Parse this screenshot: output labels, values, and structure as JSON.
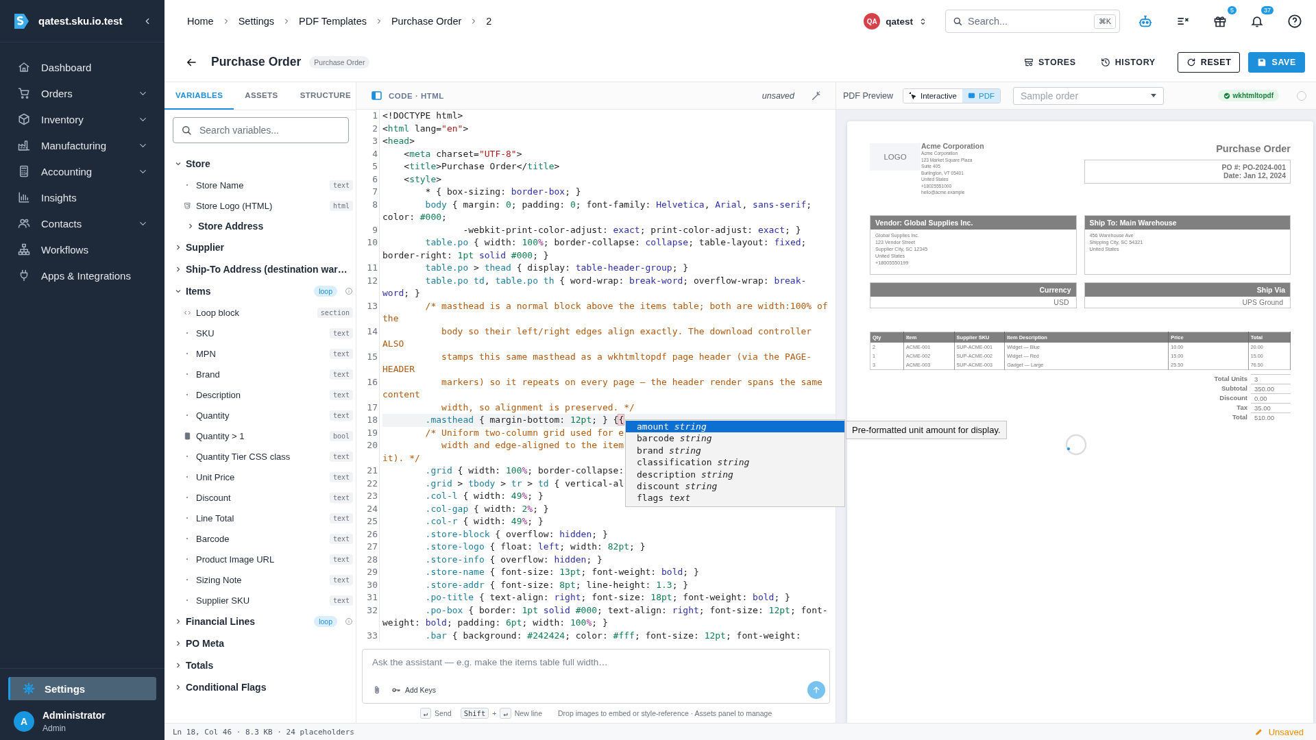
{
  "sidebar": {
    "workspace": "qatest.sku.io.test",
    "nav": [
      {
        "label": "Dashboard",
        "has_submenu": false,
        "selected": false
      },
      {
        "label": "Orders",
        "has_submenu": true,
        "selected": false
      },
      {
        "label": "Inventory",
        "has_submenu": true,
        "selected": false
      },
      {
        "label": "Manufacturing",
        "has_submenu": true,
        "selected": false
      },
      {
        "label": "Accounting",
        "has_submenu": true,
        "selected": false
      },
      {
        "label": "Insights",
        "has_submenu": false,
        "selected": false
      },
      {
        "label": "Contacts",
        "has_submenu": true,
        "selected": false
      },
      {
        "label": "Workflows",
        "has_submenu": false,
        "selected": false
      },
      {
        "label": "Apps & Integrations",
        "has_submenu": false,
        "selected": false
      }
    ],
    "footer_nav": [
      {
        "label": "Settings",
        "selected": true
      }
    ],
    "user": {
      "initial": "A",
      "name": "Administrator",
      "role": "Admin"
    }
  },
  "top_bar": {
    "breadcrumbs": [
      "Home",
      "Settings",
      "PDF Templates",
      "Purchase Order",
      "2"
    ],
    "account": {
      "initials": "QA",
      "name": "qatest"
    },
    "search": {
      "placeholder": "Search...",
      "shortcut": "⌘K"
    },
    "gift_badge": "5",
    "bell_badge": "37"
  },
  "title_bar": {
    "title": "Purchase Order",
    "type_badge": "Purchase Order",
    "actions": [
      {
        "label": "STORES",
        "kind": "text"
      },
      {
        "label": "HISTORY",
        "kind": "text"
      },
      {
        "label": "RESET",
        "kind": "outlined"
      },
      {
        "label": "SAVE",
        "kind": "primary"
      }
    ]
  },
  "variables_panel": {
    "tabs": [
      {
        "label": "VARIABLES",
        "selected": true
      },
      {
        "label": "ASSETS",
        "selected": false
      },
      {
        "label": "STRUCTURE",
        "selected": false
      }
    ],
    "search": {
      "placeholder": "Search variables..."
    },
    "tree": [
      {
        "label": "Store",
        "kind": "group",
        "expanded": true,
        "children": [
          {
            "label": "Store Name",
            "kind": "field",
            "type": "text"
          },
          {
            "label": "Store Logo (HTML)",
            "kind": "html",
            "type": "html"
          },
          {
            "label": "Store Address",
            "kind": "group",
            "expanded": false
          }
        ]
      },
      {
        "label": "Supplier",
        "kind": "group",
        "expanded": false
      },
      {
        "label": "Ship-To Address (destination war…",
        "kind": "group",
        "expanded": false
      },
      {
        "label": "Items",
        "kind": "group",
        "expanded": true,
        "badge": "loop",
        "children": [
          {
            "label": "Loop block",
            "kind": "block",
            "type": "section"
          },
          {
            "label": "SKU",
            "kind": "field",
            "type": "text"
          },
          {
            "label": "MPN",
            "kind": "field",
            "type": "text"
          },
          {
            "label": "Brand",
            "kind": "field",
            "type": "text"
          },
          {
            "label": "Description",
            "kind": "field",
            "type": "text"
          },
          {
            "label": "Quantity",
            "kind": "field",
            "type": "text"
          },
          {
            "label": "Quantity > 1",
            "kind": "condition",
            "type": "bool"
          },
          {
            "label": "Quantity Tier CSS class",
            "kind": "field",
            "type": "text"
          },
          {
            "label": "Unit Price",
            "kind": "field",
            "type": "text"
          },
          {
            "label": "Discount",
            "kind": "field",
            "type": "text"
          },
          {
            "label": "Line Total",
            "kind": "field",
            "type": "text"
          },
          {
            "label": "Barcode",
            "kind": "field",
            "type": "text"
          },
          {
            "label": "Product Image URL",
            "kind": "field",
            "type": "text"
          },
          {
            "label": "Sizing Note",
            "kind": "field",
            "type": "text"
          },
          {
            "label": "Supplier SKU",
            "kind": "field",
            "type": "text"
          }
        ]
      },
      {
        "label": "Financial Lines",
        "kind": "group",
        "expanded": false,
        "badge": "loop"
      },
      {
        "label": "PO Meta",
        "kind": "group",
        "expanded": false
      },
      {
        "label": "Totals",
        "kind": "group",
        "expanded": false
      },
      {
        "label": "Conditional Flags",
        "kind": "group",
        "expanded": false
      }
    ]
  },
  "editor": {
    "title": "CODE · HTML",
    "status": "unsaved",
    "lines": [
      {
        "number": "1",
        "current": false,
        "rows": [
          {
            "tokens": [
              {
                "kind": "plain",
                "text": "<!DOCTYPE html>"
              }
            ]
          }
        ]
      },
      {
        "number": "2",
        "current": false,
        "rows": [
          {
            "tokens": [
              {
                "kind": "plain",
                "text": "<"
              },
              {
                "kind": "tag",
                "text": "html"
              },
              {
                "kind": "plain",
                "text": " lang="
              },
              {
                "kind": "string",
                "text": "\"en\""
              },
              {
                "kind": "plain",
                "text": ">"
              }
            ]
          }
        ]
      },
      {
        "number": "3",
        "current": false,
        "rows": [
          {
            "tokens": [
              {
                "kind": "plain",
                "text": "<"
              },
              {
                "kind": "tag",
                "text": "head"
              },
              {
                "kind": "plain",
                "text": ">"
              }
            ]
          }
        ]
      },
      {
        "number": "4",
        "current": false,
        "rows": [
          {
            "tokens": [
              {
                "kind": "plain",
                "text": "    <"
              },
              {
                "kind": "tag",
                "text": "meta"
              },
              {
                "kind": "plain",
                "text": " charset="
              },
              {
                "kind": "string",
                "text": "\"UTF-8\""
              },
              {
                "kind": "plain",
                "text": ">"
              }
            ]
          }
        ]
      },
      {
        "number": "5",
        "current": false,
        "rows": [
          {
            "tokens": [
              {
                "kind": "plain",
                "text": "    <"
              },
              {
                "kind": "tag",
                "text": "title"
              },
              {
                "kind": "plain",
                "text": ">Purchase Order</"
              },
              {
                "kind": "tag",
                "text": "title"
              },
              {
                "kind": "plain",
                "text": ">"
              }
            ]
          }
        ]
      },
      {
        "number": "6",
        "current": false,
        "rows": [
          {
            "tokens": [
              {
                "kind": "plain",
                "text": "    <"
              },
              {
                "kind": "tag",
                "text": "style"
              },
              {
                "kind": "plain",
                "text": ">"
              }
            ]
          }
        ]
      },
      {
        "number": "7",
        "current": false,
        "rows": [
          {
            "tokens": [
              {
                "kind": "plain",
                "text": "        * { box-sizing: "
              },
              {
                "kind": "keyword",
                "text": "border-box"
              },
              {
                "kind": "plain",
                "text": "; }"
              }
            ]
          }
        ]
      },
      {
        "number": "8",
        "current": false,
        "rows": [
          {
            "tokens": [
              {
                "kind": "selector",
                "text": "        body"
              },
              {
                "kind": "plain",
                "text": " { margin: "
              },
              {
                "kind": "number",
                "text": "0"
              },
              {
                "kind": "plain",
                "text": "; padding: "
              },
              {
                "kind": "number",
                "text": "0"
              },
              {
                "kind": "plain",
                "text": "; font-family: "
              },
              {
                "kind": "keyword",
                "text": "Helvetica"
              },
              {
                "kind": "plain",
                "text": ", "
              },
              {
                "kind": "keyword",
                "text": "Arial"
              },
              {
                "kind": "plain",
                "text": ", "
              },
              {
                "kind": "keyword",
                "text": "sans-serif"
              },
              {
                "kind": "plain",
                "text": ";"
              }
            ]
          },
          {
            "tokens": [
              {
                "kind": "plain",
                "text": "color: "
              },
              {
                "kind": "number",
                "text": "#000"
              },
              {
                "kind": "plain",
                "text": ";"
              }
            ]
          }
        ]
      },
      {
        "number": "9",
        "current": false,
        "rows": [
          {
            "tokens": [
              {
                "kind": "plain",
                "text": "               -webkit-print-color-adjust: "
              },
              {
                "kind": "keyword",
                "text": "exact"
              },
              {
                "kind": "plain",
                "text": "; print-color-adjust: "
              },
              {
                "kind": "keyword",
                "text": "exact"
              },
              {
                "kind": "plain",
                "text": "; }"
              }
            ]
          }
        ]
      },
      {
        "number": "10",
        "current": false,
        "rows": [
          {
            "tokens": [
              {
                "kind": "selector",
                "text": "        table.po"
              },
              {
                "kind": "plain",
                "text": " { width: "
              },
              {
                "kind": "number",
                "text": "100"
              },
              {
                "kind": "unit",
                "text": "%"
              },
              {
                "kind": "plain",
                "text": "; border-collapse: "
              },
              {
                "kind": "keyword",
                "text": "collapse"
              },
              {
                "kind": "plain",
                "text": "; table-layout: "
              },
              {
                "kind": "keyword",
                "text": "fixed"
              },
              {
                "kind": "plain",
                "text": ";"
              }
            ]
          },
          {
            "tokens": [
              {
                "kind": "plain",
                "text": "border-right: "
              },
              {
                "kind": "number",
                "text": "1pt"
              },
              {
                "kind": "keyword",
                "text": " solid "
              },
              {
                "kind": "number",
                "text": "#000"
              },
              {
                "kind": "plain",
                "text": "; }"
              }
            ]
          }
        ]
      },
      {
        "number": "11",
        "current": false,
        "rows": [
          {
            "tokens": [
              {
                "kind": "selector",
                "text": "        table.po"
              },
              {
                "kind": "plain",
                "text": " > "
              },
              {
                "kind": "selector",
                "text": "thead"
              },
              {
                "kind": "plain",
                "text": " { display: "
              },
              {
                "kind": "keyword",
                "text": "table-header-group"
              },
              {
                "kind": "plain",
                "text": "; }"
              }
            ]
          }
        ]
      },
      {
        "number": "12",
        "current": false,
        "rows": [
          {
            "tokens": [
              {
                "kind": "selector",
                "text": "        table.po td"
              },
              {
                "kind": "plain",
                "text": ", "
              },
              {
                "kind": "selector",
                "text": "table.po th"
              },
              {
                "kind": "plain",
                "text": " { word-wrap: "
              },
              {
                "kind": "keyword",
                "text": "break-word"
              },
              {
                "kind": "plain",
                "text": "; overflow-wrap: "
              },
              {
                "kind": "keyword",
                "text": "break-"
              }
            ]
          },
          {
            "tokens": [
              {
                "kind": "keyword",
                "text": "word"
              },
              {
                "kind": "plain",
                "text": "; }"
              }
            ]
          }
        ]
      },
      {
        "number": "13",
        "current": false,
        "rows": [
          {
            "tokens": [
              {
                "kind": "comment",
                "text": "        /* masthead is a normal block above the items table; both are width:100% of"
              }
            ]
          },
          {
            "tokens": [
              {
                "kind": "comment",
                "text": "the"
              }
            ]
          }
        ]
      },
      {
        "number": "14",
        "current": false,
        "rows": [
          {
            "tokens": [
              {
                "kind": "comment",
                "text": "           body so their left/right edges align exactly. The download controller"
              }
            ]
          },
          {
            "tokens": [
              {
                "kind": "comment",
                "text": "ALSO"
              }
            ]
          }
        ]
      },
      {
        "number": "15",
        "current": false,
        "rows": [
          {
            "tokens": [
              {
                "kind": "comment",
                "text": "           stamps this same masthead as a wkhtmltopdf page header (via the PAGE-"
              }
            ]
          },
          {
            "tokens": [
              {
                "kind": "comment",
                "text": "HEADER"
              }
            ]
          }
        ]
      },
      {
        "number": "16",
        "current": false,
        "rows": [
          {
            "tokens": [
              {
                "kind": "comment",
                "text": "           markers) so it repeats on every page — the header render spans the same"
              }
            ]
          },
          {
            "tokens": [
              {
                "kind": "comment",
                "text": "content"
              }
            ]
          }
        ]
      },
      {
        "number": "17",
        "current": false,
        "rows": [
          {
            "tokens": [
              {
                "kind": "comment",
                "text": "           width, so alignment is preserved. */"
              }
            ]
          }
        ]
      },
      {
        "number": "18",
        "current": true,
        "rows": [
          {
            "tokens": [
              {
                "kind": "selector",
                "text": "        .masthead"
              },
              {
                "kind": "plain",
                "text": " { margin-bottom: "
              },
              {
                "kind": "number",
                "text": "12pt"
              },
              {
                "kind": "plain",
                "text": "; } {"
              },
              {
                "kind": "bracket",
                "text": "{"
              }
            ]
          }
        ]
      },
      {
        "number": "19",
        "current": false,
        "rows": [
          {
            "tokens": [
              {
                "kind": "comment",
                "text": "        /* Uniform two-column grid used for e"
              }
            ]
          }
        ]
      },
      {
        "number": "20",
        "current": false,
        "rows": [
          {
            "tokens": [
              {
                "kind": "comment",
                "text": "           width and edge-aligned to the item"
              }
            ]
          },
          {
            "tokens": [
              {
                "kind": "comment",
                "text": "it). */"
              }
            ]
          }
        ]
      },
      {
        "number": "21",
        "current": false,
        "rows": [
          {
            "tokens": [
              {
                "kind": "selector",
                "text": "        .grid"
              },
              {
                "kind": "plain",
                "text": " { width: "
              },
              {
                "kind": "number",
                "text": "100"
              },
              {
                "kind": "unit",
                "text": "%"
              },
              {
                "kind": "plain",
                "text": "; border-collapse:"
              }
            ]
          }
        ]
      },
      {
        "number": "22",
        "current": false,
        "rows": [
          {
            "tokens": [
              {
                "kind": "selector",
                "text": "        .grid"
              },
              {
                "kind": "plain",
                "text": " > "
              },
              {
                "kind": "selector",
                "text": "tbody"
              },
              {
                "kind": "plain",
                "text": " > "
              },
              {
                "kind": "selector",
                "text": "tr"
              },
              {
                "kind": "plain",
                "text": " > "
              },
              {
                "kind": "selector",
                "text": "td"
              },
              {
                "kind": "plain",
                "text": " { vertical-al"
              }
            ]
          }
        ]
      },
      {
        "number": "23",
        "current": false,
        "rows": [
          {
            "tokens": [
              {
                "kind": "selector",
                "text": "        .col-l"
              },
              {
                "kind": "plain",
                "text": " { width: "
              },
              {
                "kind": "number",
                "text": "49"
              },
              {
                "kind": "unit",
                "text": "%"
              },
              {
                "kind": "plain",
                "text": "; }"
              }
            ]
          }
        ]
      },
      {
        "number": "24",
        "current": false,
        "rows": [
          {
            "tokens": [
              {
                "kind": "selector",
                "text": "        .col-gap"
              },
              {
                "kind": "plain",
                "text": " { width: "
              },
              {
                "kind": "number",
                "text": "2"
              },
              {
                "kind": "unit",
                "text": "%"
              },
              {
                "kind": "plain",
                "text": "; }"
              }
            ]
          }
        ]
      },
      {
        "number": "25",
        "current": false,
        "rows": [
          {
            "tokens": [
              {
                "kind": "selector",
                "text": "        .col-r"
              },
              {
                "kind": "plain",
                "text": " { width: "
              },
              {
                "kind": "number",
                "text": "49"
              },
              {
                "kind": "unit",
                "text": "%"
              },
              {
                "kind": "plain",
                "text": "; }"
              }
            ]
          }
        ]
      },
      {
        "number": "26",
        "current": false,
        "rows": [
          {
            "tokens": [
              {
                "kind": "selector",
                "text": "        .store-block"
              },
              {
                "kind": "plain",
                "text": " { overflow: "
              },
              {
                "kind": "keyword",
                "text": "hidden"
              },
              {
                "kind": "plain",
                "text": "; }"
              }
            ]
          }
        ]
      },
      {
        "number": "27",
        "current": false,
        "rows": [
          {
            "tokens": [
              {
                "kind": "selector",
                "text": "        .store-logo"
              },
              {
                "kind": "plain",
                "text": " { float: "
              },
              {
                "kind": "keyword",
                "text": "left"
              },
              {
                "kind": "plain",
                "text": "; width: "
              },
              {
                "kind": "number",
                "text": "82pt"
              },
              {
                "kind": "plain",
                "text": "; }"
              }
            ]
          }
        ]
      },
      {
        "number": "28",
        "current": false,
        "rows": [
          {
            "tokens": [
              {
                "kind": "selector",
                "text": "        .store-info"
              },
              {
                "kind": "plain",
                "text": " { overflow: "
              },
              {
                "kind": "keyword",
                "text": "hidden"
              },
              {
                "kind": "plain",
                "text": "; }"
              }
            ]
          }
        ]
      },
      {
        "number": "29",
        "current": false,
        "rows": [
          {
            "tokens": [
              {
                "kind": "selector",
                "text": "        .store-name"
              },
              {
                "kind": "plain",
                "text": " { font-size: "
              },
              {
                "kind": "number",
                "text": "13pt"
              },
              {
                "kind": "plain",
                "text": "; font-weight: "
              },
              {
                "kind": "keyword",
                "text": "bold"
              },
              {
                "kind": "plain",
                "text": "; }"
              }
            ]
          }
        ]
      },
      {
        "number": "30",
        "current": false,
        "rows": [
          {
            "tokens": [
              {
                "kind": "selector",
                "text": "        .store-addr"
              },
              {
                "kind": "plain",
                "text": " { font-size: "
              },
              {
                "kind": "number",
                "text": "8pt"
              },
              {
                "kind": "plain",
                "text": "; line-height: "
              },
              {
                "kind": "number",
                "text": "1.3"
              },
              {
                "kind": "plain",
                "text": "; }"
              }
            ]
          }
        ]
      },
      {
        "number": "31",
        "current": false,
        "rows": [
          {
            "tokens": [
              {
                "kind": "selector",
                "text": "        .po-title"
              },
              {
                "kind": "plain",
                "text": " { text-align: "
              },
              {
                "kind": "keyword",
                "text": "right"
              },
              {
                "kind": "plain",
                "text": "; font-size: "
              },
              {
                "kind": "number",
                "text": "18pt"
              },
              {
                "kind": "plain",
                "text": "; font-weight: "
              },
              {
                "kind": "keyword",
                "text": "bold"
              },
              {
                "kind": "plain",
                "text": "; }"
              }
            ]
          }
        ]
      },
      {
        "number": "32",
        "current": false,
        "rows": [
          {
            "tokens": [
              {
                "kind": "selector",
                "text": "        .po-box"
              },
              {
                "kind": "plain",
                "text": " { border: "
              },
              {
                "kind": "number",
                "text": "1pt"
              },
              {
                "kind": "keyword",
                "text": " solid "
              },
              {
                "kind": "number",
                "text": "#000"
              },
              {
                "kind": "plain",
                "text": "; text-align: "
              },
              {
                "kind": "keyword",
                "text": "right"
              },
              {
                "kind": "plain",
                "text": "; font-size: "
              },
              {
                "kind": "number",
                "text": "12pt"
              },
              {
                "kind": "plain",
                "text": "; font-"
              }
            ]
          },
          {
            "tokens": [
              {
                "kind": "plain",
                "text": "weight: "
              },
              {
                "kind": "keyword",
                "text": "bold"
              },
              {
                "kind": "plain",
                "text": "; padding: "
              },
              {
                "kind": "number",
                "text": "6pt"
              },
              {
                "kind": "plain",
                "text": "; width: "
              },
              {
                "kind": "number",
                "text": "100"
              },
              {
                "kind": "unit",
                "text": "%"
              },
              {
                "kind": "plain",
                "text": "; }"
              }
            ]
          }
        ]
      },
      {
        "number": "33",
        "current": false,
        "rows": [
          {
            "tokens": [
              {
                "kind": "selector",
                "text": "        .bar"
              },
              {
                "kind": "plain",
                "text": " { background: "
              },
              {
                "kind": "number",
                "text": "#242424"
              },
              {
                "kind": "plain",
                "text": "; color: "
              },
              {
                "kind": "number",
                "text": "#fff"
              },
              {
                "kind": "plain",
                "text": "; font-size: "
              },
              {
                "kind": "number",
                "text": "12pt"
              },
              {
                "kind": "plain",
                "text": "; font-weight:"
              }
            ]
          }
        ]
      }
    ],
    "autocomplete": {
      "items": [
        {
          "name": "amount",
          "type": "string",
          "selected": true
        },
        {
          "name": "barcode",
          "type": "string",
          "selected": false
        },
        {
          "name": "brand",
          "type": "string",
          "selected": false
        },
        {
          "name": "classification",
          "type": "string",
          "selected": false
        },
        {
          "name": "description",
          "type": "string",
          "selected": false
        },
        {
          "name": "discount",
          "type": "string",
          "selected": false
        },
        {
          "name": "flags",
          "type": "text",
          "selected": false
        }
      ],
      "detail": "Pre-formatted unit amount for display."
    },
    "assistant": {
      "placeholder": "Ask the assistant — e.g. make the items table full width…",
      "add_keys": "Add Keys",
      "hints": [
        {
          "kind": "key",
          "text": "↵"
        },
        {
          "kind": "label",
          "text": "Send"
        },
        {
          "kind": "key",
          "text": "Shift"
        },
        {
          "kind": "plus",
          "text": "+"
        },
        {
          "kind": "key",
          "text": "↵"
        },
        {
          "kind": "label",
          "text": "New line"
        },
        {
          "kind": "note",
          "text": "Drop images to embed or style-reference · Assets panel to manage"
        }
      ]
    }
  },
  "preview": {
    "label": "PDF Preview",
    "modes": [
      {
        "label": "Interactive",
        "selected": false
      },
      {
        "label": "PDF",
        "selected": true
      }
    ],
    "sample_select": {
      "placeholder": "Sample order"
    },
    "engine": "wkhtmltopdf",
    "loading": true,
    "document": {
      "logo": "LOGO",
      "company": "Acme Corporation",
      "address": [
        "Acme Corporation",
        "123 Market Square Plaza",
        "Suite 405",
        "Burlington, VT 05401",
        "United States",
        "+18025551000",
        "hello@acme.example"
      ],
      "title": "Purchase Order",
      "po_box": [
        "PO #: PO-2024-001",
        "Date: Jan 12, 2024"
      ],
      "parties": [
        {
          "heading": "Vendor: Global Supplies Inc.",
          "lines": [
            "Global Supplies Inc.",
            "123 Vendor Street",
            "Supplier City, SC 12345",
            "United States",
            "+18005550199"
          ]
        },
        {
          "heading": "Ship To: Main Warehouse",
          "lines": [
            "456 Warehouse Ave",
            "Shipping City, SC 54321",
            "United States"
          ]
        }
      ],
      "fields": [
        {
          "label": "Currency",
          "value": "USD"
        },
        {
          "label": "Ship Via",
          "value": "UPS Ground"
        }
      ],
      "items_table": {
        "columns": [
          "Qty",
          "Item",
          "Supplier SKU",
          "Item Description",
          "Price",
          "Total"
        ],
        "rows": [
          [
            "2",
            "ACME-001",
            "SUP-ACME-001",
            "Widget — Blue",
            "10.00",
            "20.00"
          ],
          [
            "1",
            "ACME-002",
            "SUP-ACME-002",
            "Widget — Red",
            "15.00",
            "15.00"
          ],
          [
            "3",
            "ACME-003",
            "SUP-ACME-003",
            "Gadget — Large",
            "25.50",
            "76.50"
          ]
        ]
      },
      "totals": [
        {
          "label": "Total Units",
          "value": "3"
        },
        {
          "label": "Subtotal",
          "value": "350.00"
        },
        {
          "label": "Discount",
          "value": "0.00"
        },
        {
          "label": "Tax",
          "value": "35.00"
        },
        {
          "label": "Total",
          "value": "510.00"
        }
      ]
    }
  },
  "status_bar": {
    "info": "Ln 18, Col 46 · 8.3 KB · 24 placeholders",
    "state": "Unsaved"
  }
}
